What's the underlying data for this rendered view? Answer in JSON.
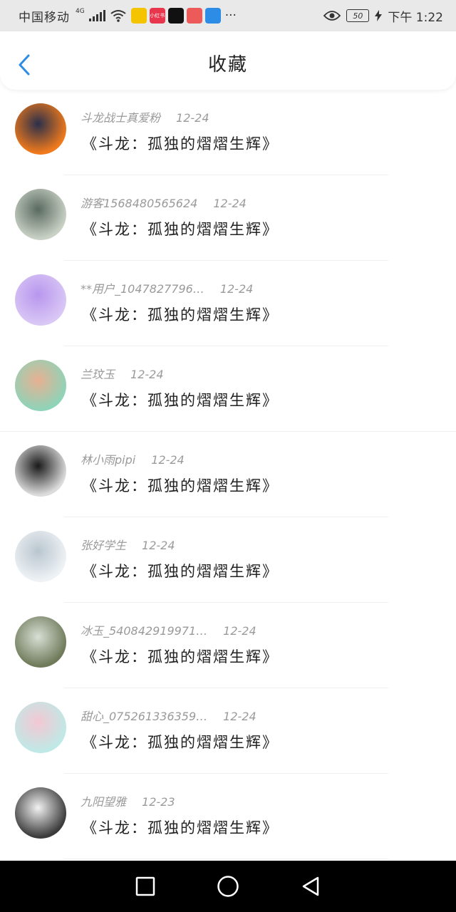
{
  "status_bar": {
    "carrier": "中国移动",
    "network": "4G",
    "apps": [
      {
        "name": "app-icon-yellow",
        "color": "#f4c400",
        "label": ""
      },
      {
        "name": "app-icon-red",
        "color": "#e8364c",
        "label": "小红书"
      },
      {
        "name": "app-icon-tiktok",
        "color": "#111111",
        "label": ""
      },
      {
        "name": "app-icon-pink",
        "color": "#ec5a5a",
        "label": ""
      },
      {
        "name": "app-icon-blue",
        "color": "#2d8de6",
        "label": ""
      }
    ],
    "more": "···",
    "battery": "50",
    "time": "下午 1:22"
  },
  "header": {
    "title": "收藏"
  },
  "items": [
    {
      "user": "斗龙战士真爱粉",
      "date": "12-24",
      "book": "《斗龙：孤独的熠熠生辉》",
      "avatar_colors": [
        "#f07a1c",
        "#2a2f4a"
      ]
    },
    {
      "user": "游客1568480565624",
      "date": "12-24",
      "book": "《斗龙：孤独的熠熠生辉》",
      "avatar_colors": [
        "#c9d1c5",
        "#5a6a60"
      ]
    },
    {
      "user": "**用户_1047827796…",
      "date": "12-24",
      "book": "《斗龙：孤独的熠熠生辉》",
      "avatar_colors": [
        "#d9c7f5",
        "#b896ee"
      ]
    },
    {
      "user": "兰玟玉",
      "date": "12-24",
      "book": "《斗龙：孤独的熠熠生辉》",
      "avatar_colors": [
        "#8fd3b8",
        "#e8b091"
      ]
    },
    {
      "user": "林小雨pipi",
      "date": "12-24",
      "book": "《斗龙：孤独的熠熠生辉》",
      "avatar_colors": [
        "#dcdcdc",
        "#1a1a1a"
      ]
    },
    {
      "user": "张好学生",
      "date": "12-24",
      "book": "《斗龙：孤独的熠熠生辉》",
      "avatar_colors": [
        "#eef2f5",
        "#b9c6cf"
      ]
    },
    {
      "user": "冰玉_540842919971…",
      "date": "12-24",
      "book": "《斗龙：孤独的熠熠生辉》",
      "avatar_colors": [
        "#6f7a5a",
        "#d8dfd5"
      ]
    },
    {
      "user": "甜心_075261336359…",
      "date": "12-24",
      "book": "《斗龙：孤独的熠熠生辉》",
      "avatar_colors": [
        "#bfe9e6",
        "#f4c7d3"
      ]
    },
    {
      "user": "九阳望雅",
      "date": "12-23",
      "book": "《斗龙：孤独的熠熠生辉》",
      "avatar_colors": [
        "#3b3b3b",
        "#f2f2f2"
      ]
    }
  ],
  "colors": {
    "accent": "#2d8de6",
    "nav_bg": "#000000"
  }
}
